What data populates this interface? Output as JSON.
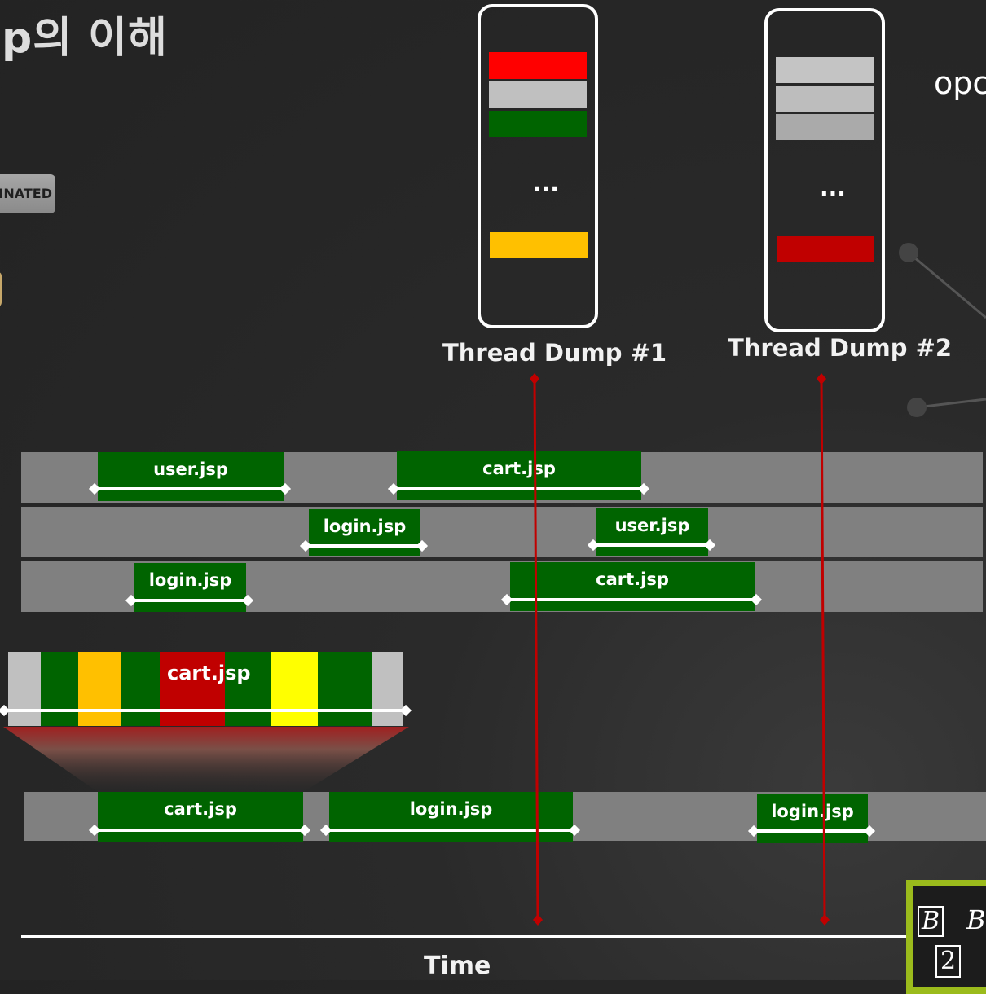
{
  "title": "p의 이해",
  "status_pill": "INATED",
  "logo_text": "opc",
  "thread_dumps": [
    {
      "label": "Thread Dump #1",
      "ellipsis": "...",
      "blocks": [
        "#ff0000",
        "#c0c0c0",
        "#006400",
        "#ffc000"
      ]
    },
    {
      "label": "Thread Dump #2",
      "ellipsis": "...",
      "blocks": [
        "#c4c4c4",
        "#bdbdbd",
        "#aaaaaa",
        "#c00000"
      ]
    }
  ],
  "lanes": [
    {
      "requests": [
        "user.jsp",
        "cart.jsp"
      ]
    },
    {
      "requests": [
        "login.jsp",
        "user.jsp"
      ]
    },
    {
      "requests": [
        "login.jsp",
        "cart.jsp"
      ]
    }
  ],
  "zoom": {
    "label": "cart.jsp",
    "segments": [
      "#c0c0c0",
      "#006400",
      "#ffc000",
      "#006400",
      "#c00000",
      "#006400",
      "#ffff00",
      "#006400",
      "#c0c0c0"
    ]
  },
  "bottom_lane": {
    "requests": [
      "cart.jsp",
      "login.jsp",
      "login.jsp"
    ]
  },
  "axis_label": "Time",
  "corner": {
    "tl": "B",
    "tr": "B",
    "bl": "2"
  },
  "colors": {
    "request": "#006400",
    "marker": "#c00000",
    "lane": "#808080",
    "accent": "#9bbb1c"
  }
}
